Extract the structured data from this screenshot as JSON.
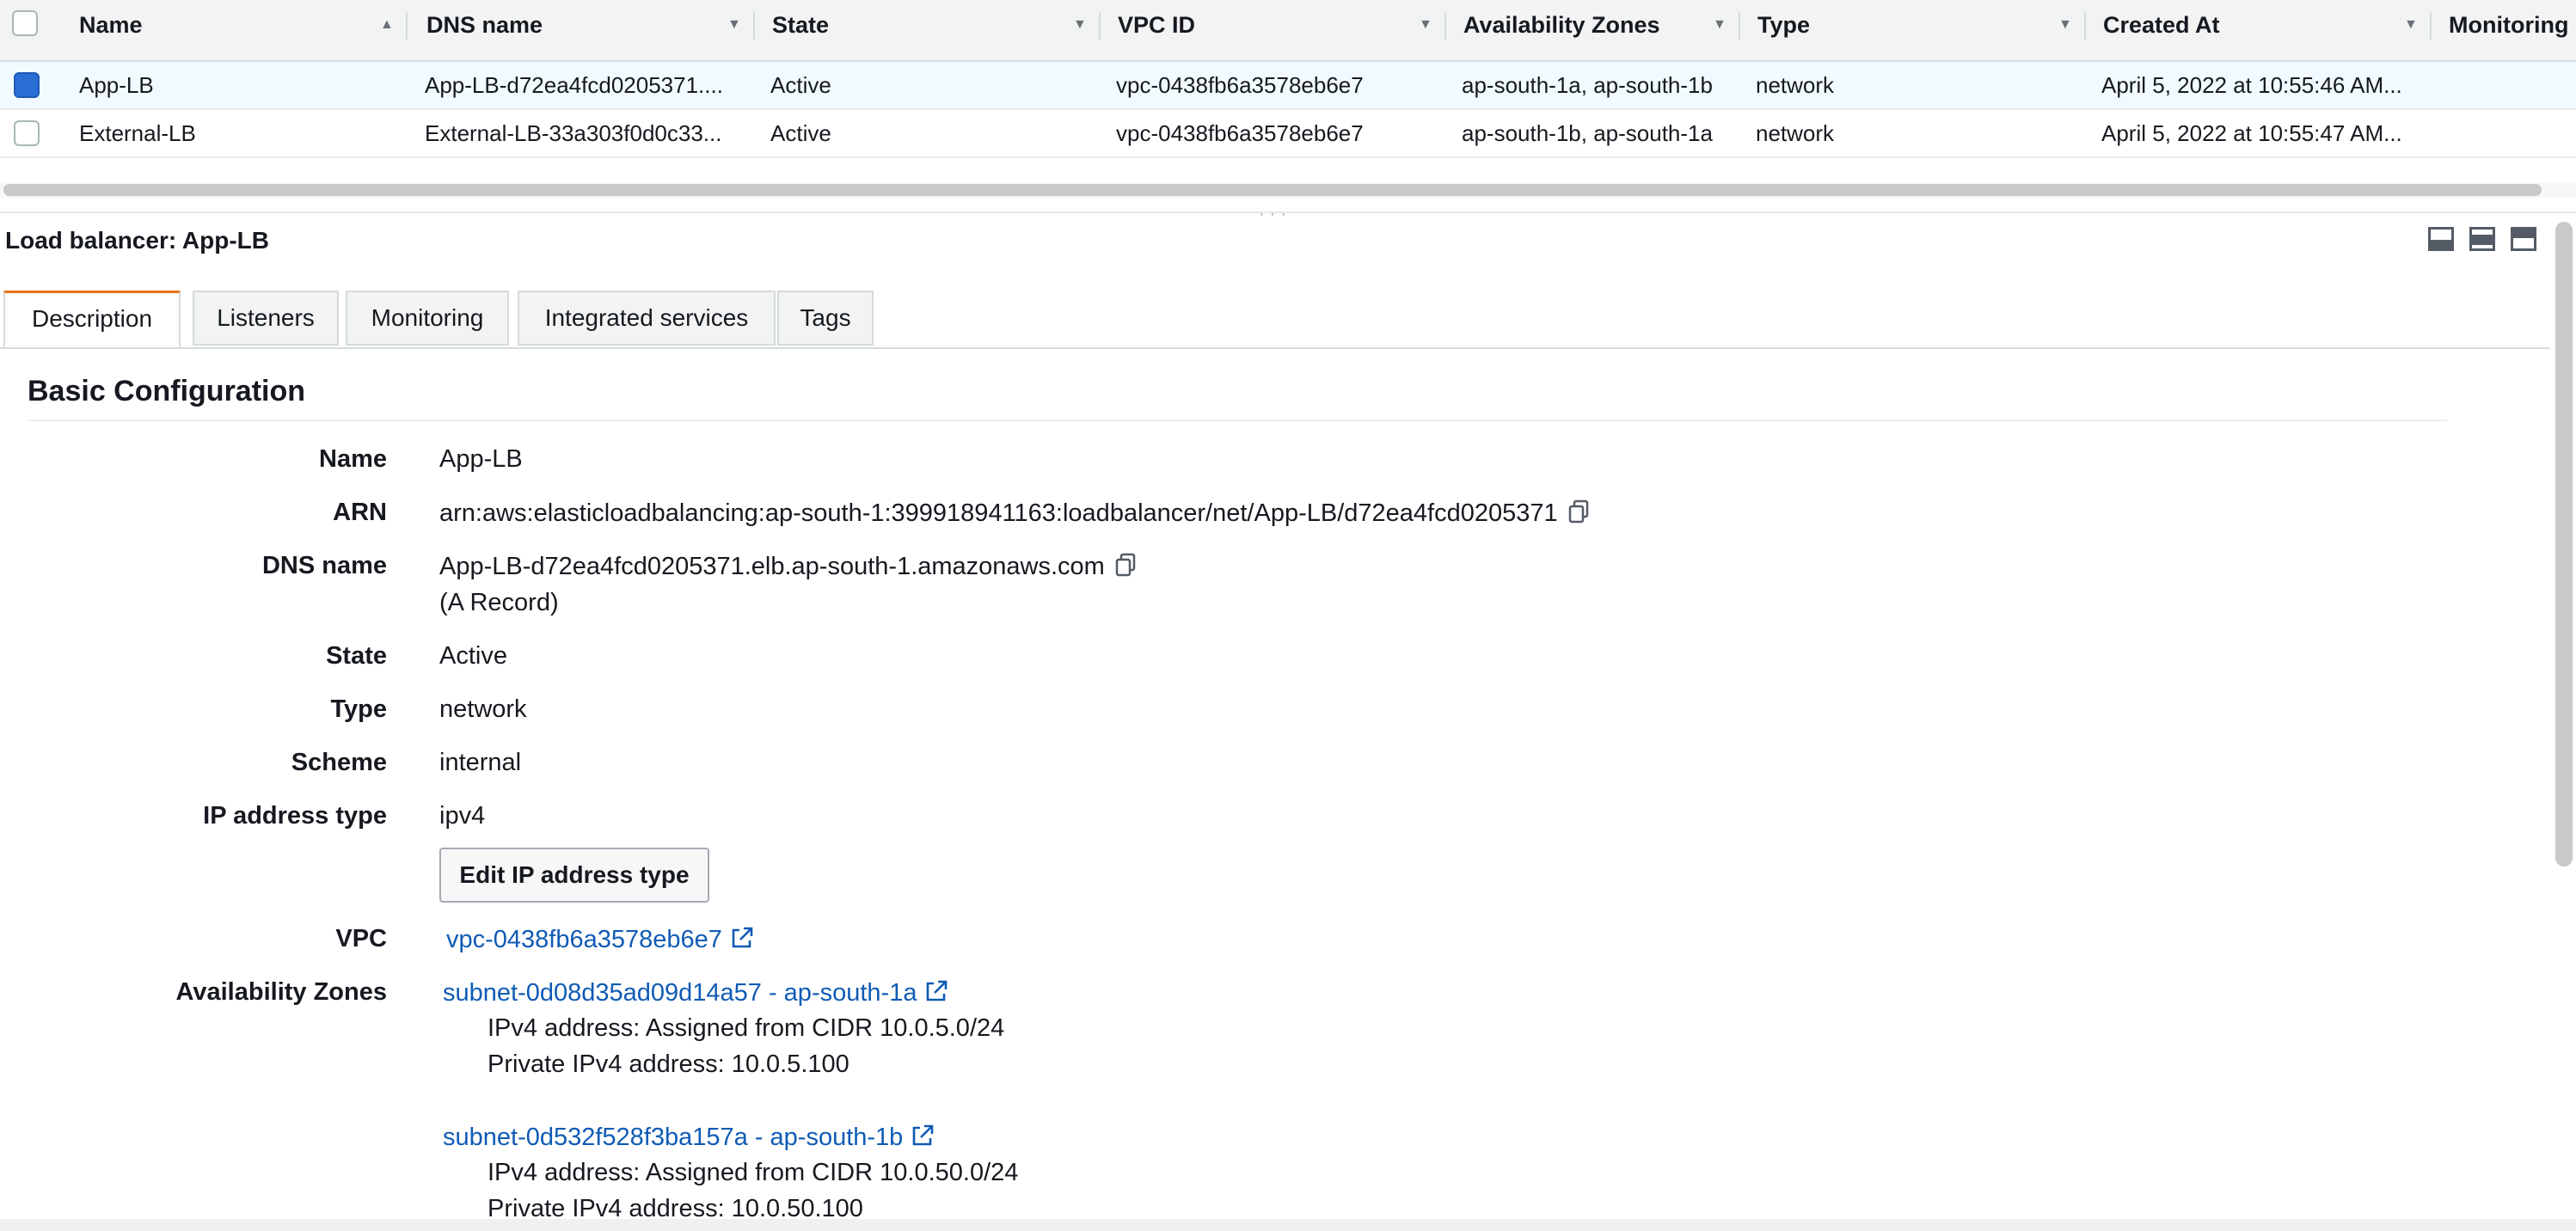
{
  "table": {
    "columns": [
      "Name",
      "DNS name",
      "State",
      "VPC ID",
      "Availability Zones",
      "Type",
      "Created At",
      "Monitoring"
    ],
    "rows": [
      {
        "name": "App-LB",
        "dns": "App-LB-d72ea4fcd0205371....",
        "state": "Active",
        "vpc": "vpc-0438fb6a3578eb6e7",
        "zones": "ap-south-1a, ap-south-1b",
        "type": "network",
        "created": "April 5, 2022 at 10:55:46 AM...",
        "selected": true
      },
      {
        "name": "External-LB",
        "dns": "External-LB-33a303f0d0c33...",
        "state": "Active",
        "vpc": "vpc-0438fb6a3578eb6e7",
        "zones": "ap-south-1b, ap-south-1a",
        "type": "network",
        "created": "April 5, 2022 at 10:55:47 AM...",
        "selected": false
      }
    ]
  },
  "detail": {
    "title": "Load balancer: App-LB",
    "tabs": [
      "Description",
      "Listeners",
      "Monitoring",
      "Integrated services",
      "Tags"
    ],
    "section_title": "Basic Configuration",
    "labels": {
      "name": "Name",
      "arn": "ARN",
      "dns": "DNS name",
      "state": "State",
      "type": "Type",
      "scheme": "Scheme",
      "ip_type": "IP address type",
      "vpc": "VPC",
      "zones": "Availability Zones"
    },
    "values": {
      "name": "App-LB",
      "arn": "arn:aws:elasticloadbalancing:ap-south-1:399918941163:loadbalancer/net/App-LB/d72ea4fcd0205371",
      "dns": "App-LB-d72ea4fcd0205371.elb.ap-south-1.amazonaws.com",
      "dns_record": "(A Record)",
      "state": "Active",
      "type": "network",
      "scheme": "internal",
      "ip_type": "ipv4",
      "vpc": "vpc-0438fb6a3578eb6e7"
    },
    "edit_ip_button": "Edit IP address type",
    "subnets": [
      {
        "link": "subnet-0d08d35ad09d14a57 - ap-south-1a",
        "ipv4": "IPv4 address: Assigned from CIDR 10.0.5.0/24",
        "private": "Private IPv4 address: 10.0.5.100"
      },
      {
        "link": "subnet-0d532f528f3ba157a - ap-south-1b",
        "ipv4": "IPv4 address: Assigned from CIDR 10.0.50.0/24",
        "private": "Private IPv4 address: 10.0.50.100"
      }
    ]
  },
  "colors": {
    "accent_tab": "#ec7211",
    "link": "#0f5bb5",
    "selected_row": "#f1faff",
    "checkbox_checked": "#2a6fd6"
  },
  "icons": {
    "copy": "copy-icon",
    "external": "external-link-icon",
    "sort": "sort-caret-icon"
  }
}
